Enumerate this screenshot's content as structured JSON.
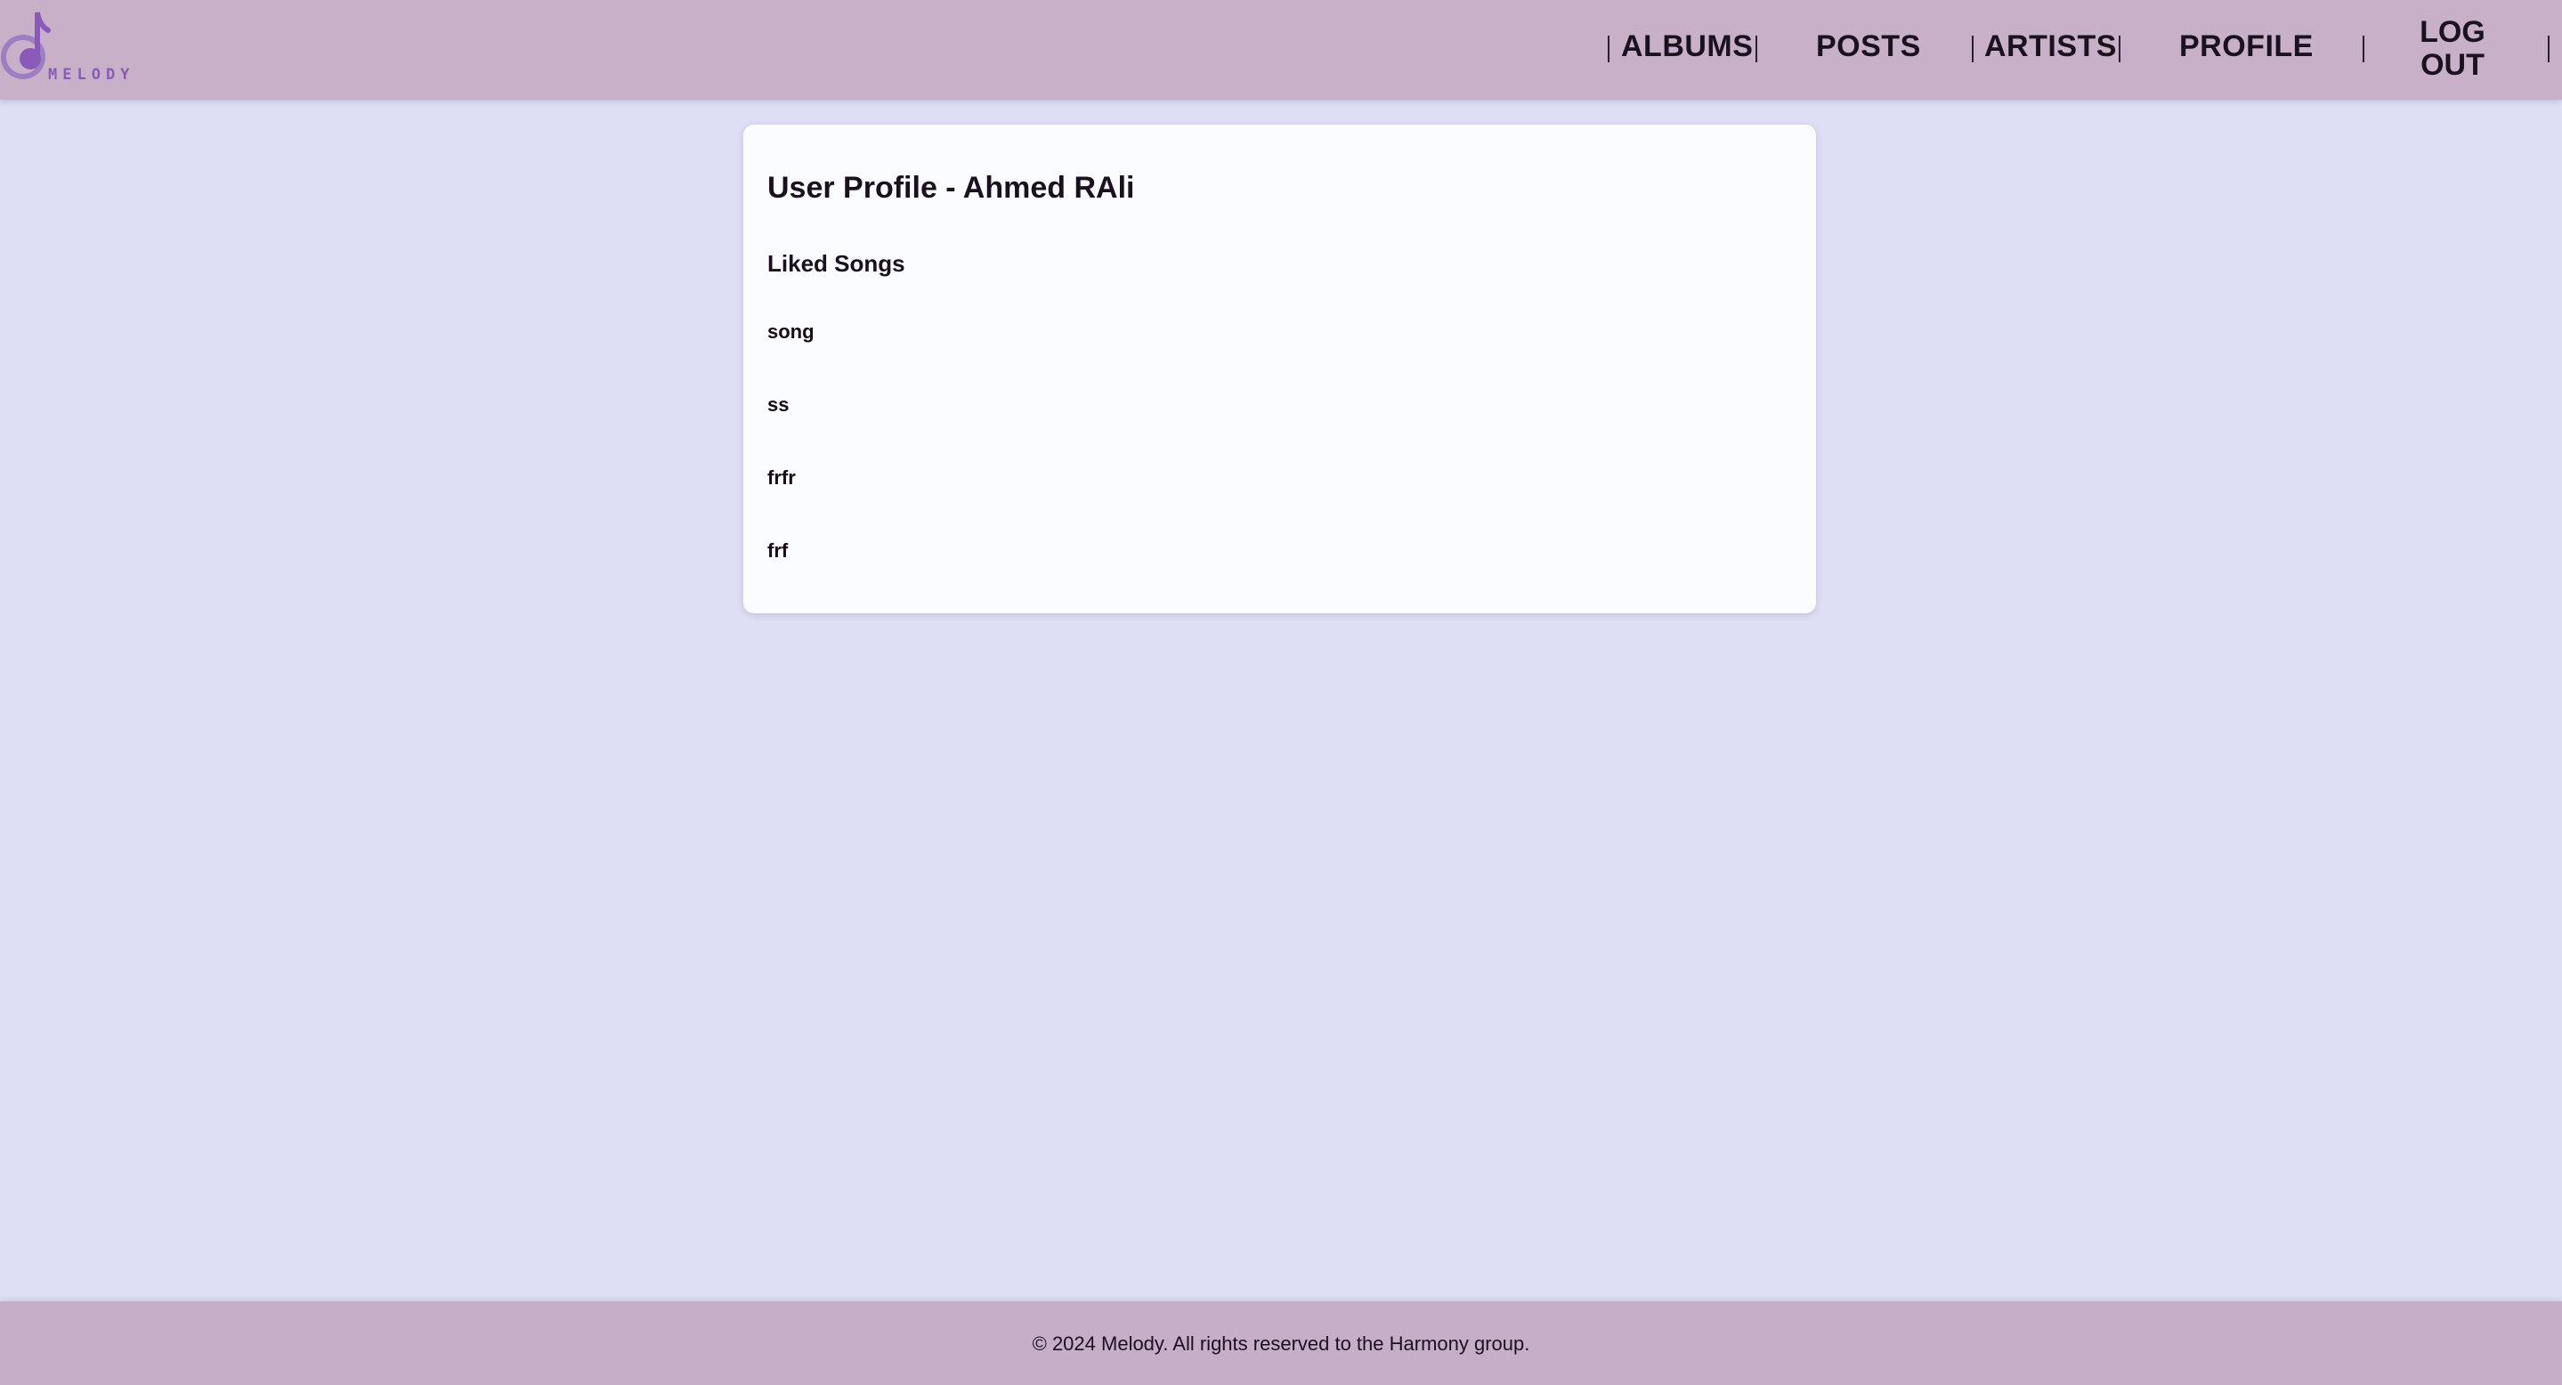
{
  "brand": {
    "logo_text": "MELODY",
    "logo_icon": "music-note-icon",
    "colors": {
      "header_bg": "#c8b0c9",
      "page_bg": "#dedff5",
      "card_bg": "#fbfcff",
      "logo_accent": "#8a5ab8"
    }
  },
  "nav": {
    "albums": "ALBUMS",
    "posts": "POSTS",
    "artists": "ARTISTS",
    "profile": "PROFILE",
    "logout_line1": "LOG",
    "logout_line2": "OUT"
  },
  "profile": {
    "title": "User Profile - Ahmed RAli",
    "liked_heading": "Liked Songs",
    "liked_songs": [
      "song",
      "ss",
      "frfr",
      "frf"
    ]
  },
  "footer": {
    "text": "© 2024 Melody. All rights reserved to the Harmony group."
  }
}
